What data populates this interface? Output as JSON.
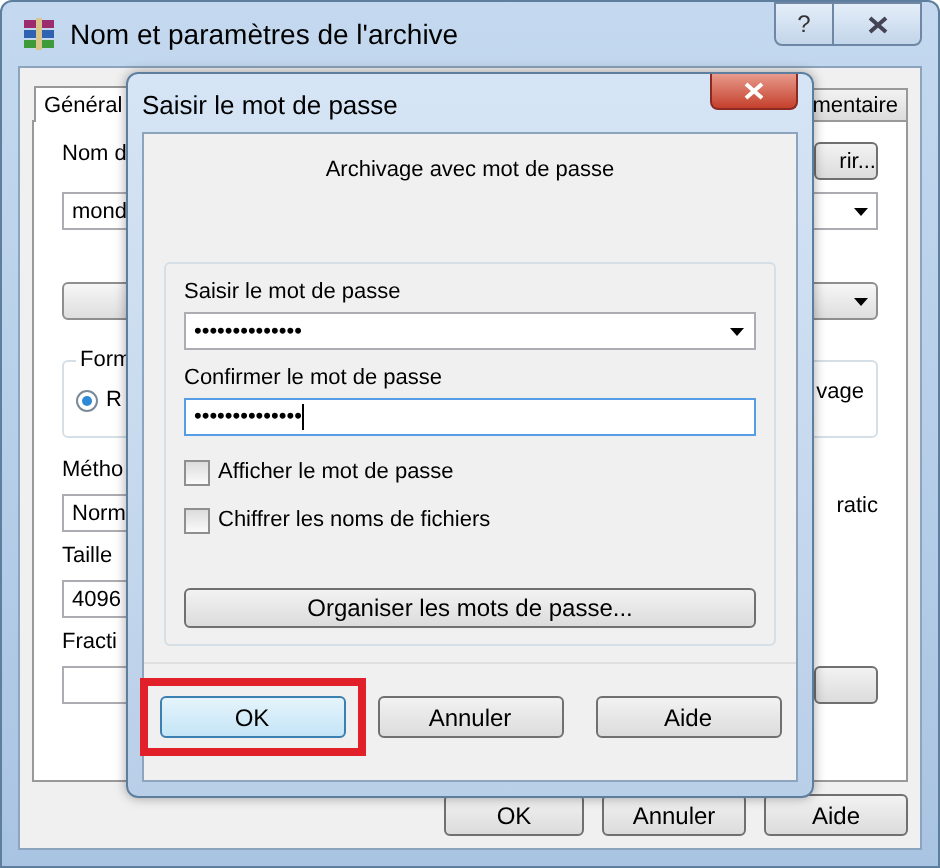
{
  "window": {
    "title": "Nom et paramètres de l'archive",
    "help_button": "?"
  },
  "tabs": [
    {
      "label": "Général",
      "selected": true
    },
    {
      "label": "mentaire",
      "selected": false
    }
  ],
  "general": {
    "name_label": "Nom d",
    "browse_button": "rir...",
    "name_value": "mond",
    "format_group": {
      "label": "Form",
      "options": [
        {
          "label": "R",
          "selected": true
        }
      ],
      "right_text": "vage"
    },
    "method": {
      "label": "Métho",
      "value": "Norm",
      "right_text": "ratic"
    },
    "size": {
      "label": "Taille",
      "value": "4096"
    },
    "split": {
      "label": "Fracti"
    }
  },
  "buttons": [
    "OK",
    "Annuler",
    "Aide"
  ],
  "dialog": {
    "title": "Saisir le mot de passe",
    "heading": "Archivage avec mot de passe",
    "password_label": "Saisir le mot de passe",
    "password_value": "••••••••••••••",
    "confirm_label": "Confirmer le mot de passe",
    "confirm_value": "••••••••••••••",
    "checkboxes": [
      {
        "label": "Afficher le mot de passe",
        "checked": false
      },
      {
        "label": "Chiffrer les noms de fichiers",
        "checked": false
      }
    ],
    "organize_button": "Organiser les mots de passe...",
    "buttons": [
      {
        "label": "OK",
        "default": true,
        "highlighted": true
      },
      {
        "label": "Annuler",
        "default": false,
        "highlighted": false
      },
      {
        "label": "Aide",
        "default": false,
        "highlighted": false
      }
    ]
  }
}
